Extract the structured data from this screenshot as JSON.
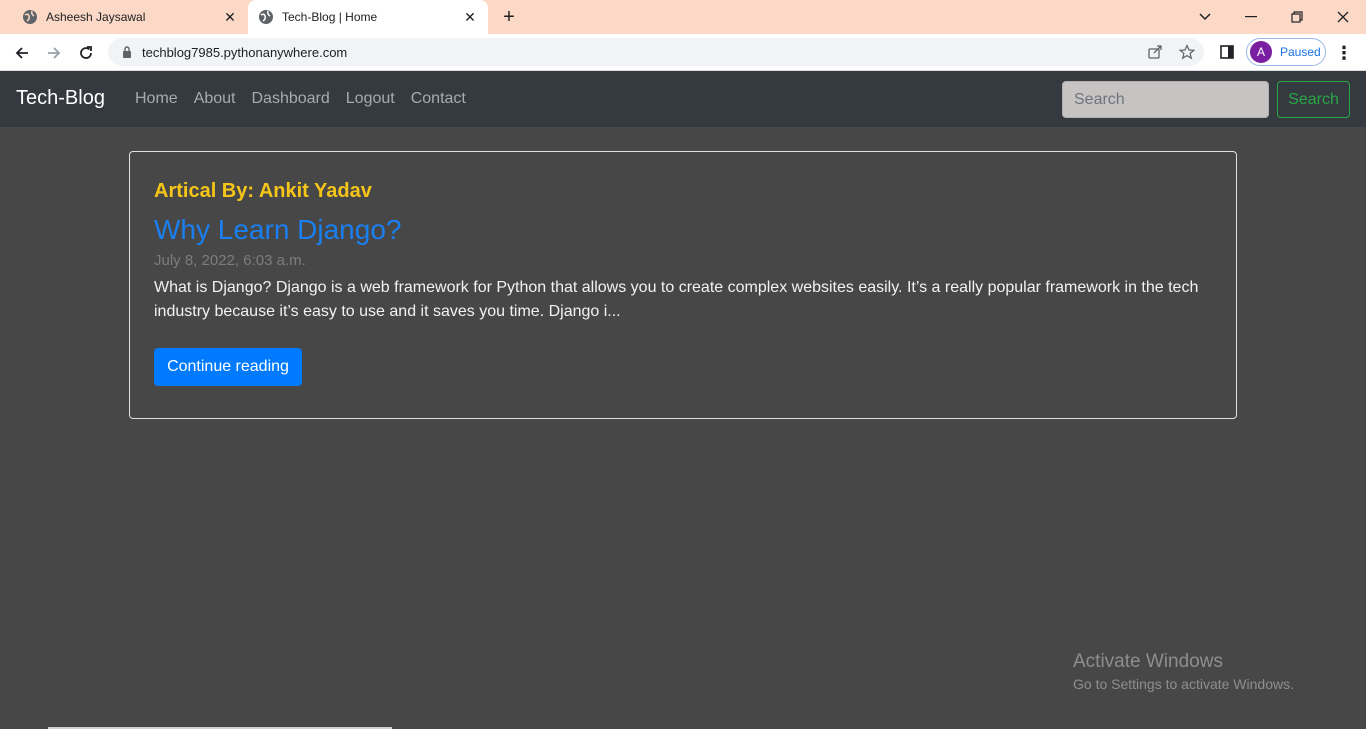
{
  "browser": {
    "tabs": [
      {
        "title": "Asheesh Jaysawal",
        "icon": "globe-icon"
      },
      {
        "title": "Tech-Blog | Home",
        "icon": "globe-icon"
      }
    ],
    "url": "techblog7985.pythonanywhere.com",
    "profile_initial": "A",
    "profile_status": "Paused"
  },
  "site": {
    "brand": "Tech-Blog",
    "nav": [
      "Home",
      "About",
      "Dashboard",
      "Logout",
      "Contact"
    ],
    "search_placeholder": "Search",
    "search_button": "Search"
  },
  "post": {
    "author_line": "Artical By: Ankit Yadav",
    "title": "Why Learn Django?",
    "date": "July 8, 2022, 6:03 a.m.",
    "excerpt": "What is Django? Django is a web framework for Python that allows you to create complex websites easily. It’s a really popular framework in the tech industry because it’s easy to use and it saves you time. Django i...",
    "button": "Continue reading"
  },
  "watermark": {
    "title": "Activate Windows",
    "subtitle": "Go to Settings to activate Windows."
  },
  "colors": {
    "page_bg": "#484748",
    "navbar_bg": "#343a40",
    "author": "#f5c518",
    "title_link": "#1a7ff0",
    "primary_button": "#007bff",
    "success": "#28a745"
  }
}
